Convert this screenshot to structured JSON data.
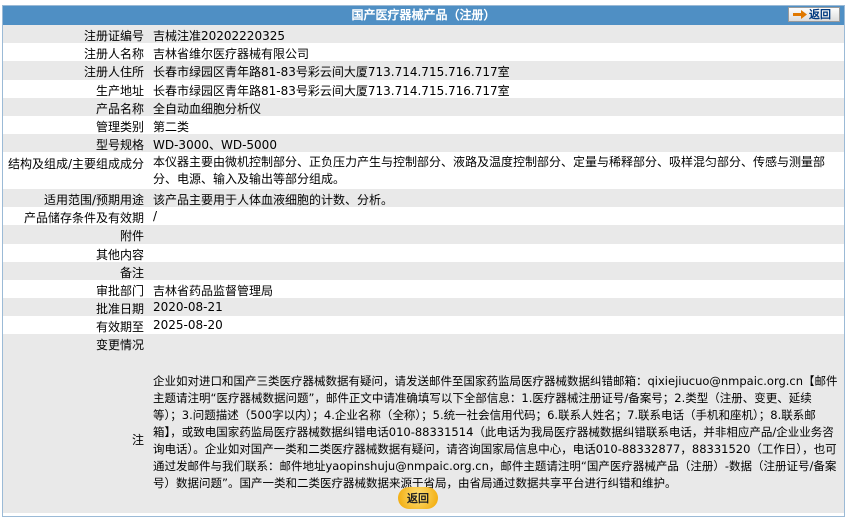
{
  "header": {
    "title": "国产医疗器械产品（注册）",
    "back_label": "返回"
  },
  "fields": [
    {
      "label": "注册证编号",
      "value": "吉械注准20202220325"
    },
    {
      "label": "注册人名称",
      "value": "吉林省维尔医疗器械有限公司"
    },
    {
      "label": "注册人住所",
      "value": "长春市绿园区青年路81-83号彩云间大厦713.714.715.716.717室"
    },
    {
      "label": "生产地址",
      "value": "长春市绿园区青年路81-83号彩云间大厦713.714.715.716.717室"
    },
    {
      "label": "产品名称",
      "value": "全自动血细胞分析仪"
    },
    {
      "label": "管理类别",
      "value": "第二类"
    },
    {
      "label": "型号规格",
      "value": "WD-3000、WD-5000"
    },
    {
      "label": "结构及组成/主要组成成分",
      "value": "本仪器主要由微机控制部分、正负压力产生与控制部分、液路及温度控制部分、定量与稀释部分、吸样混匀部分、传感与测量部分、电源、输入及输出等部分组成。"
    },
    {
      "label": "适用范围/预期用途",
      "value": "该产品主要用于人体血液细胞的计数、分析。"
    },
    {
      "label": "产品储存条件及有效期",
      "value": "/"
    },
    {
      "label": "附件",
      "value": ""
    },
    {
      "label": "其他内容",
      "value": ""
    },
    {
      "label": "备注",
      "value": ""
    },
    {
      "label": "审批部门",
      "value": "吉林省药品监督管理局"
    },
    {
      "label": "批准日期",
      "value": "2020-08-21"
    },
    {
      "label": "有效期至",
      "value": "2025-08-20"
    },
    {
      "label": "变更情况",
      "value": ""
    },
    {
      "label": "注",
      "value": "企业如对进口和国产三类医疗器械数据有疑问，请发送邮件至国家药监局医疗器械数据纠错邮箱：qixiejiucuo@nmpaic.org.cn【邮件主题请注明“医疗器械数据问题”，邮件正文中请准确填写以下全部信息：1.医疗器械注册证号/备案号；2.类型（注册、变更、延续等）；3.问题描述（500字以内）；4.企业名称（全称）；5.统一社会信用代码；6.联系人姓名；7.联系电话（手机和座机）；8.联系邮箱】，或致电国家药监局医疗器械数据纠错电话010-88331514（此电话为我局医疗器械数据纠错联系电话，并非相应产品/企业业务咨询电话）。企业如对国产一类和二类医疗器械数据有疑问，请咨询国家局信息中心，电话010-88332877，88331520（工作日），也可通过发邮件与我们联系：邮件地址yaopinshuju@nmpaic.org.cn，邮件主题请注明“国产医疗器械产品（注册）-数据（注册证号/备案号）数据问题”。国产一类和二类医疗器械数据来源于省局，由省局通过数据共享平台进行纠错和维护。"
    }
  ],
  "footer": {
    "back_label": "返回"
  },
  "colors": {
    "title_bar": "#4f8fc4",
    "row_odd": "#e9e9e9",
    "row_even": "#ffffff",
    "back_button": "#f0a500"
  }
}
